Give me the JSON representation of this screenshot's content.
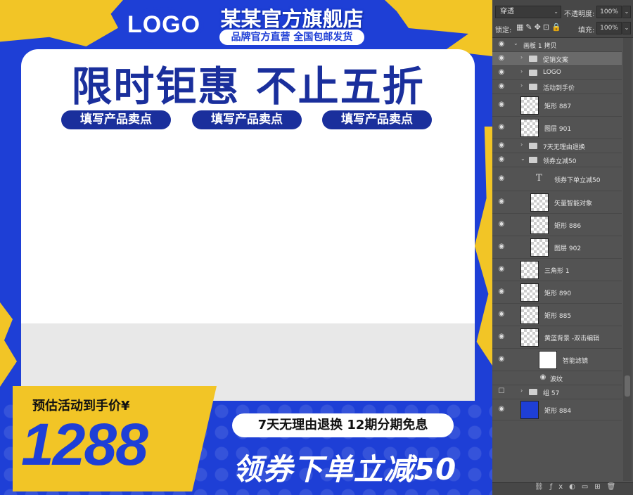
{
  "canvas": {
    "logo": "LOGO",
    "store_name": "某某官方旗舰店",
    "store_sub": "品牌官方直营  全国包邮发货",
    "headline": "限时钜惠 不止五折",
    "selling_points": [
      "填写产品卖点",
      "填写产品卖点",
      "填写产品卖点"
    ],
    "price_label": "预估活动到手价¥",
    "price_value": "1288",
    "policy": "7天无理由退换  12期分期免息",
    "coupon": "领券下单立减50"
  },
  "panel": {
    "blend_mode": "穿透",
    "opacity_label": "不透明度:",
    "opacity_value": "100%",
    "lock_label": "锁定:",
    "fill_label": "填充:",
    "fill_value": "100%",
    "layers": [
      {
        "name": "画板 1 拷贝",
        "kind": "artboard",
        "indent": 0
      },
      {
        "name": "促销文案",
        "kind": "group",
        "indent": 1,
        "selected": true
      },
      {
        "name": "LOGO",
        "kind": "group",
        "indent": 1
      },
      {
        "name": "活动到手价",
        "kind": "group",
        "indent": 1
      },
      {
        "name": "矩形 887",
        "kind": "shape",
        "indent": 1
      },
      {
        "name": "图层 901",
        "kind": "layer",
        "indent": 1
      },
      {
        "name": "7天无理由退换",
        "kind": "group",
        "indent": 1
      },
      {
        "name": "领券立减50",
        "kind": "group-open",
        "indent": 1
      },
      {
        "name": "领券下单立减50",
        "kind": "text",
        "indent": 2
      },
      {
        "name": "矢量智能对象",
        "kind": "smart",
        "indent": 2
      },
      {
        "name": "矩形 886",
        "kind": "shape",
        "indent": 2
      },
      {
        "name": "图层 902",
        "kind": "layer",
        "indent": 2
      },
      {
        "name": "三角形 1",
        "kind": "shape",
        "indent": 1
      },
      {
        "name": "矩形 890",
        "kind": "shape",
        "indent": 1
      },
      {
        "name": "矩形 885",
        "kind": "shape",
        "indent": 1
      },
      {
        "name": "黄蓝背景 -双击编辑",
        "kind": "smart",
        "indent": 1
      },
      {
        "name": "智能滤镜",
        "kind": "filter",
        "indent": 2
      },
      {
        "name": "波纹",
        "kind": "filter-item",
        "indent": 2
      },
      {
        "name": "组 57",
        "kind": "group",
        "indent": 1,
        "hidden": true
      },
      {
        "name": "矩形 884",
        "kind": "shape-blue",
        "indent": 1
      }
    ]
  },
  "colors": {
    "blue": "#1e3fd6",
    "yellow": "#f2c526",
    "navy": "#1a2f9c"
  }
}
